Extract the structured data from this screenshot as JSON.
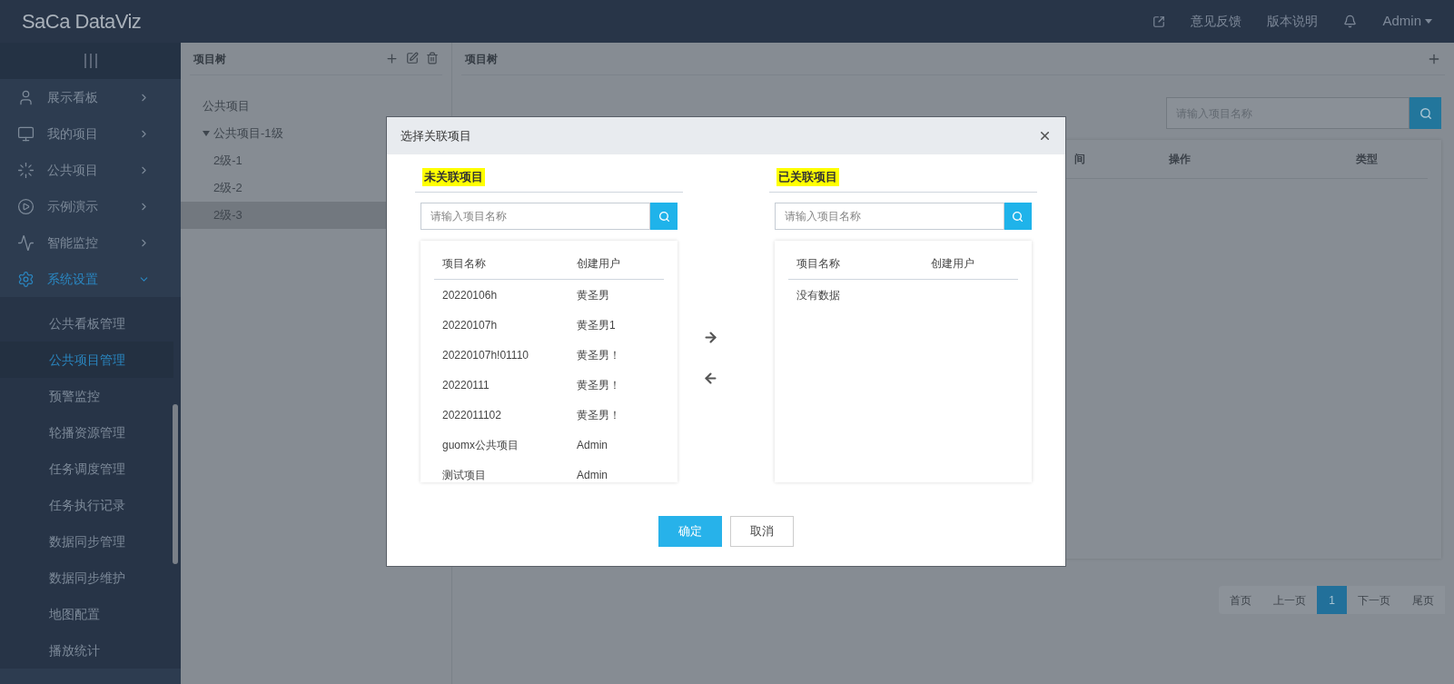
{
  "header": {
    "logo": "SaCa DataViz",
    "links": [
      "意见反馈",
      "版本说明"
    ],
    "user": "Admin"
  },
  "sidebar": {
    "items": [
      {
        "label": "展示看板",
        "expanded": false
      },
      {
        "label": "我的项目",
        "expanded": false
      },
      {
        "label": "公共项目",
        "expanded": false
      },
      {
        "label": "示例演示",
        "expanded": false
      },
      {
        "label": "智能监控",
        "expanded": false
      },
      {
        "label": "系统设置",
        "expanded": true,
        "children": [
          {
            "label": "公共看板管理",
            "selected": false
          },
          {
            "label": "公共项目管理",
            "selected": true
          },
          {
            "label": "预警监控",
            "selected": false
          },
          {
            "label": "轮播资源管理",
            "selected": false
          },
          {
            "label": "任务调度管理",
            "selected": false
          },
          {
            "label": "任务执行记录",
            "selected": false
          },
          {
            "label": "数据同步管理",
            "selected": false
          },
          {
            "label": "数据同步维护",
            "selected": false
          },
          {
            "label": "地图配置",
            "selected": false
          },
          {
            "label": "播放统计",
            "selected": false
          }
        ]
      }
    ]
  },
  "tree_panel": {
    "title": "项目树",
    "tree": [
      {
        "label": "公共项目",
        "selected": false
      },
      {
        "label": "公共项目-1级",
        "selected": false,
        "expanded": true,
        "children": [
          {
            "label": "2级-1",
            "selected": false
          },
          {
            "label": "2级-2",
            "selected": false
          },
          {
            "label": "2级-3",
            "selected": true
          }
        ]
      }
    ]
  },
  "main_panel": {
    "title": "项目树",
    "search": {
      "placeholder": "请输入项目名称"
    },
    "columns": [
      "间",
      "操作",
      "类型"
    ],
    "pagination": [
      {
        "label": "首页",
        "selected": false
      },
      {
        "label": "上一页",
        "selected": false
      },
      {
        "label": "1",
        "selected": true
      },
      {
        "label": "下一页",
        "selected": false
      },
      {
        "label": "尾页",
        "selected": false
      }
    ]
  },
  "dialog": {
    "title": "选择关联项目",
    "lists": [
      {
        "title": "未关联项目",
        "search": {
          "placeholder": "请输入项目名称"
        },
        "columns": [
          "项目名称",
          "创建用户"
        ],
        "rows": [
          [
            "20220106h",
            "黄圣男"
          ],
          [
            "20220107h",
            "黄圣男1"
          ],
          [
            "20220107h!01110",
            "黄圣男！"
          ],
          [
            "20220111",
            "黄圣男！"
          ],
          [
            "2022011102",
            "黄圣男！"
          ],
          [
            "guomx公共项目",
            "Admin"
          ],
          [
            "测试项目",
            "Admin"
          ]
        ]
      },
      {
        "title": "已关联项目",
        "search": {
          "placeholder": "请输入项目名称"
        },
        "columns": [
          "项目名称",
          "创建用户"
        ],
        "empty": "没有数据"
      }
    ],
    "buttons": [
      {
        "label": "确定",
        "kind": "primary"
      },
      {
        "label": "取消",
        "kind": "default"
      }
    ]
  }
}
